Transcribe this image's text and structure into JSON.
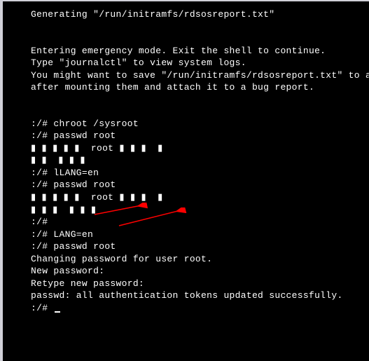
{
  "terminal": {
    "lines": [
      "Generating \"/run/initramfs/rdsosreport.txt\"",
      "",
      "",
      "Entering emergency mode. Exit the shell to continue.",
      "Type \"journalctl\" to view system logs.",
      "You might want to save \"/run/initramfs/rdsosreport.txt\" to a",
      "after mounting them and attach it to a bug report.",
      "",
      "",
      ":/# chroot /sysroot",
      ":/# passwd root",
      "▮ ▮ ▮ ▮ ▮  root ▮ ▮ ▮  ▮",
      "▮ ▮  ▮ ▮ ▮",
      ":/# lLANG=en",
      ":/# passwd root",
      "▮ ▮ ▮ ▮ ▮  root ▮ ▮ ▮  ▮",
      "▮ ▮ ▮  ▮ ▮ ▮",
      ":/#",
      ":/# LANG=en",
      ":/# passwd root",
      "Changing password for user root.",
      "New password:",
      "Retype new password:",
      "passwd: all authentication tokens updated successfully.",
      ":/# "
    ],
    "cursor_after_last": true
  },
  "annotations": {
    "arrow1": {
      "points_to": "LANG=en line"
    },
    "arrow2": {
      "points_to": "passwd root line"
    }
  }
}
